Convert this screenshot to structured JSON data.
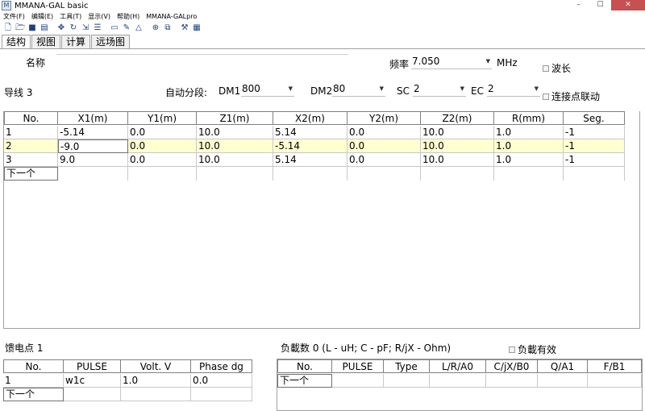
{
  "window": {
    "title": "MMANA-GAL basic",
    "controls": [
      "–",
      "☐",
      "✕"
    ]
  },
  "menu": [
    "文件(F)",
    "编辑(E)",
    "工具(T)",
    "显示(V)",
    "帮助(H)",
    "MMANA-GALpro"
  ],
  "tabs": [
    "结构",
    "视图",
    "计算",
    "远场图"
  ],
  "header": {
    "name_label": "名称",
    "freq_label": "频率",
    "freq_value": "7.050",
    "freq_unit": "MHz",
    "wavelength_label": "波长",
    "wires_label": "导线 3",
    "autoseg_label": "自动分段:",
    "dm1_label": "DM1",
    "dm1_value": "800",
    "dm2_label": "DM2",
    "dm2_value": "80",
    "sc_label": "SC",
    "sc_value": "2",
    "ec_label": "EC",
    "ec_value": "2",
    "link_label": "连接点联动"
  },
  "wires": {
    "columns": [
      "No.",
      "X1(m)",
      "Y1(m)",
      "Z1(m)",
      "X2(m)",
      "Y2(m)",
      "Z2(m)",
      "R(mm)",
      "Seg."
    ],
    "rows": [
      [
        "1",
        "-5.14",
        "0.0",
        "10.0",
        "5.14",
        "0.0",
        "10.0",
        "1.0",
        "-1"
      ],
      [
        "2",
        "-9.0",
        "0.0",
        "10.0",
        "-5.14",
        "0.0",
        "10.0",
        "1.0",
        "-1"
      ],
      [
        "3",
        "9.0",
        "0.0",
        "10.0",
        "5.14",
        "0.0",
        "10.0",
        "1.0",
        "-1"
      ]
    ],
    "next_label": "下一个"
  },
  "sources": {
    "title": "馈电点 1",
    "columns": [
      "No.",
      "PULSE",
      "Volt. V",
      "Phase dg"
    ],
    "rows": [
      [
        "1",
        "w1c",
        "1.0",
        "0.0"
      ]
    ],
    "next_label": "下一个"
  },
  "loads": {
    "title": "负載数 0 (L - uH; C - pF; R/jX - Ohm)",
    "enable_label": "负載有效",
    "columns": [
      "No.",
      "PULSE",
      "Type",
      "L/R/A0",
      "C/jX/B0",
      "Q/A1",
      "F/B1"
    ],
    "next_label": "下一个"
  },
  "toolbar_icons": [
    "new-icon",
    "open-icon",
    "save-icon",
    "info-icon",
    "move-icon",
    "rotate-icon",
    "scale-icon",
    "edit-icon",
    "doc-icon",
    "pencil-icon",
    "triangle-icon",
    "target-icon",
    "copy-icon",
    "tools-icon",
    "calculator-icon"
  ]
}
